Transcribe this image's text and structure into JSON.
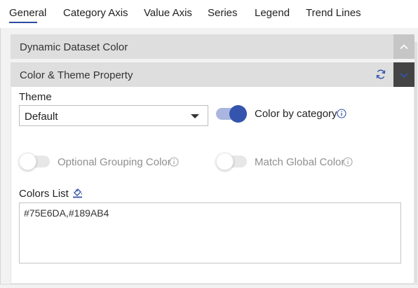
{
  "tabs": [
    {
      "label": "General",
      "active": true
    },
    {
      "label": "Category Axis",
      "active": false
    },
    {
      "label": "Value Axis",
      "active": false
    },
    {
      "label": "Series",
      "active": false
    },
    {
      "label": "Legend",
      "active": false
    },
    {
      "label": "Trend Lines",
      "active": false
    }
  ],
  "sections": {
    "dynamic_dataset": {
      "title": "Dynamic Dataset Color",
      "expanded": false
    },
    "color_theme": {
      "title": "Color & Theme Property",
      "expanded": true
    }
  },
  "theme": {
    "label": "Theme",
    "selected": "Default"
  },
  "color_by_category": {
    "label": "Color by category",
    "on": true
  },
  "optional_grouping": {
    "label": "Optional Grouping Color",
    "on": false,
    "disabled": true
  },
  "match_global": {
    "label": "Match Global Color",
    "on": false,
    "disabled": true
  },
  "colors_list": {
    "label": "Colors List",
    "value": "#75E6DA,#189AB4"
  },
  "colors": {
    "accent": "#3554ad",
    "accent_light": "#aab6df",
    "header_bg": "#dedede",
    "panel_bg": "#f2f2f2"
  }
}
